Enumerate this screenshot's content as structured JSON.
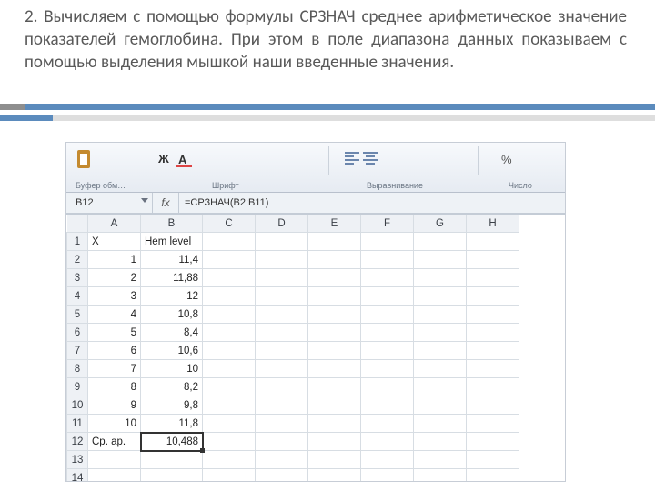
{
  "paragraph": "2. Вычисляем с помощью формулы СРЗНАЧ среднее арифметическое значение показателей гемоглобина. При этом в поле диапазона данных показываем с помощью выделения мышкой наши введенные значения.",
  "ribbon": {
    "group_clipboard": "Буфер обм…",
    "group_font": "Шрифт",
    "group_align": "Выравнивание",
    "group_number": "Число"
  },
  "namebox": "B12",
  "fx_label": "fx",
  "formula": "=СРЗНАЧ(B2:B11)",
  "columns": [
    "A",
    "B",
    "C",
    "D",
    "E",
    "F",
    "G",
    "H"
  ],
  "rows": [
    {
      "n": "1",
      "a": "X",
      "b": "Hem level"
    },
    {
      "n": "2",
      "a": "1",
      "b": "11,4"
    },
    {
      "n": "3",
      "a": "2",
      "b": "11,88"
    },
    {
      "n": "4",
      "a": "3",
      "b": "12"
    },
    {
      "n": "5",
      "a": "4",
      "b": "10,8"
    },
    {
      "n": "6",
      "a": "5",
      "b": "8,4"
    },
    {
      "n": "7",
      "a": "6",
      "b": "10,6"
    },
    {
      "n": "8",
      "a": "7",
      "b": "10"
    },
    {
      "n": "9",
      "a": "8",
      "b": "8,2"
    },
    {
      "n": "10",
      "a": "9",
      "b": "9,8"
    },
    {
      "n": "11",
      "a": "10",
      "b": "11,8"
    },
    {
      "n": "12",
      "a": "Ср. ар.",
      "b": "10,488",
      "active": true
    },
    {
      "n": "13",
      "a": "",
      "b": ""
    },
    {
      "n": "14",
      "a": "",
      "b": ""
    }
  ]
}
